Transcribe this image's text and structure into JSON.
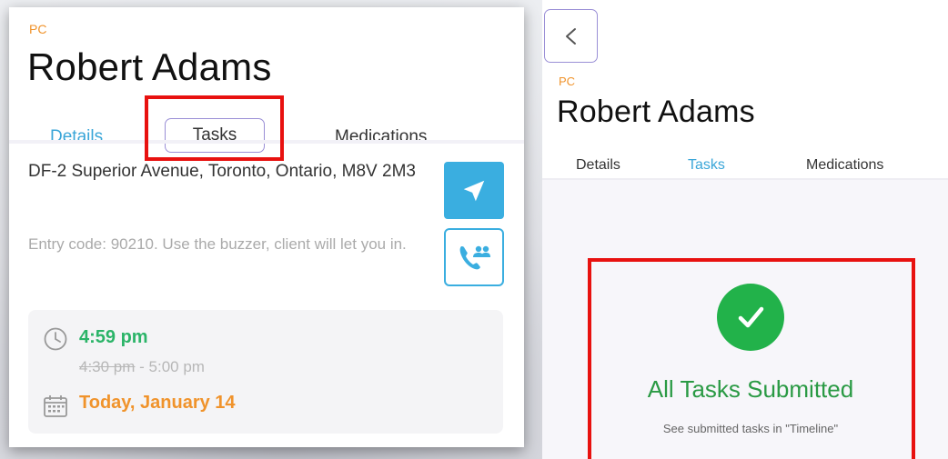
{
  "left_panel": {
    "role_tag": "PC",
    "client_name": "Robert Adams",
    "tabs": [
      {
        "label": "Details"
      },
      {
        "label": "Tasks"
      },
      {
        "label": "Medications"
      }
    ],
    "address": "DF-2 Superior Avenue, Toronto, Ontario, M8V 2M3",
    "entry_note": "Entry code: 90210. Use the buzzer, client will let you in.",
    "visit": {
      "actual_time": "4:59 pm",
      "scheduled_start": "4:30 pm",
      "scheduled_sep": " - ",
      "scheduled_end": "5:00 pm",
      "date": "Today, January 14"
    }
  },
  "right_panel": {
    "role_tag": "PC",
    "client_name": "Robert Adams",
    "tabs": [
      {
        "label": "Details"
      },
      {
        "label": "Tasks"
      },
      {
        "label": "Medications"
      }
    ],
    "status_title": "All Tasks Submitted",
    "status_subtitle": "See submitted tasks in \"Timeline\""
  },
  "colors": {
    "accent_orange": "#f0932b",
    "accent_blue": "#3aaee0",
    "success_green": "#22b24a",
    "highlight_red": "#e8110f"
  },
  "icons": [
    "navigate-arrow-icon",
    "phone-group-icon",
    "clock-icon",
    "calendar-icon",
    "back-chevron-icon",
    "checkmark-icon"
  ]
}
